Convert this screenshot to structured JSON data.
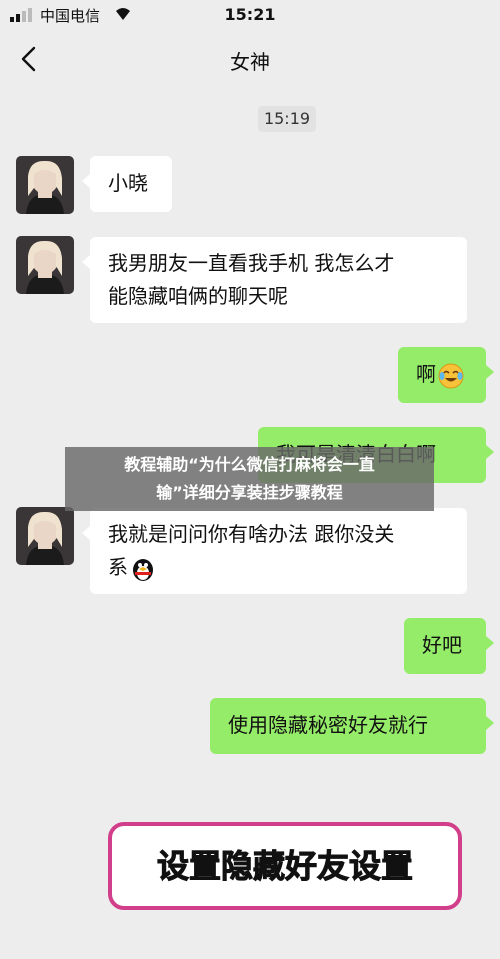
{
  "status_bar": {
    "carrier": "中国电信",
    "time": "15:21"
  },
  "nav": {
    "title": "女神"
  },
  "chat": {
    "timestamp": "15:19",
    "messages": [
      {
        "side": "in",
        "text": "小晓"
      },
      {
        "side": "in",
        "line1": "我男朋友一直看我手机 我怎么才",
        "line2": "能隐藏咱俩的聊天呢"
      },
      {
        "side": "out",
        "text": "啊",
        "emoji": "crying-laughing-emoji"
      },
      {
        "side": "out",
        "text": "我可是清清白白啊"
      },
      {
        "side": "in",
        "line1": "我就是问问你有啥办法 跟你没关",
        "line2": "系",
        "emoji": "penguin-emoji"
      },
      {
        "side": "out",
        "text": "好吧"
      },
      {
        "side": "out",
        "text": "使用隐藏秘密好友就行"
      }
    ]
  },
  "overlay": {
    "line1": "教程辅助“为什么微信打麻将会一直",
    "line2": "输”详细分享装挂步骤教程"
  },
  "highlight": {
    "text": "设置隐藏好友设置"
  },
  "colors": {
    "background": "#ededed",
    "incoming": "#ffffff",
    "outgoing": "#95ec69",
    "highlight_border": "#d13f8a"
  }
}
